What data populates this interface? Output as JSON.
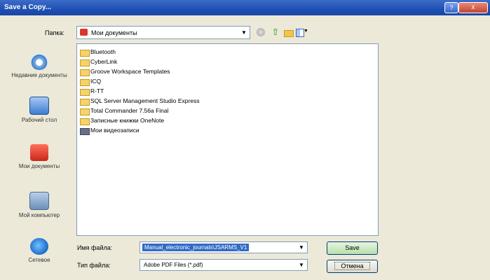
{
  "window": {
    "title": "Save a Copy...",
    "close_glyph": "x",
    "help_glyph": "?"
  },
  "lookin": {
    "label": "Папка:",
    "value": "Мои документы"
  },
  "places": [
    {
      "label": "Недавние документы"
    },
    {
      "label": "Рабочий стол"
    },
    {
      "label": "Мои документы"
    },
    {
      "label": "Мой компьютер"
    },
    {
      "label": "Сетевое"
    }
  ],
  "files": [
    {
      "name": "Bluetooth"
    },
    {
      "name": "CyberLink"
    },
    {
      "name": "Groove Workspace Templates"
    },
    {
      "name": "ICQ"
    },
    {
      "name": "R-TT"
    },
    {
      "name": "SQL Server Management Studio Express"
    },
    {
      "name": "Total Commander 7.56a Final"
    },
    {
      "name": "Записные книжки OneNote"
    },
    {
      "name": "Мои видеозаписи"
    }
  ],
  "filename": {
    "label": "Имя файла:",
    "value": "Manual_electronic_journals\\JSARMS_V1"
  },
  "filetype": {
    "label": "Тип файла:",
    "value": "Adobe PDF Files (*.pdf)"
  },
  "buttons": {
    "save": "Save",
    "cancel": "Отмена"
  }
}
